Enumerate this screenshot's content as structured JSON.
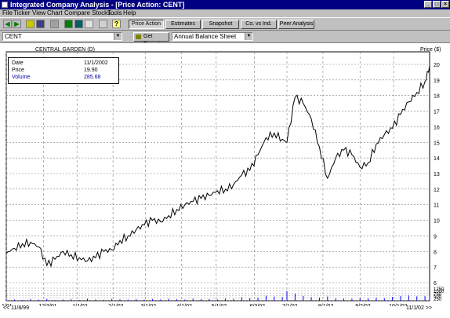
{
  "window": {
    "title": "Integrated Company Analysis - [Price Action:  CENT]",
    "controls": [
      "_",
      "□",
      "×"
    ]
  },
  "menu": [
    "File",
    "Ticker",
    "View",
    "Chart",
    "Compare Stocks...",
    "Tools",
    "Help"
  ],
  "toolbar": {
    "icons": [
      "back-arrow-icon",
      "forward-arrow-icon",
      "open-folder-icon",
      "save-icon",
      "print-icon",
      "chart-icon",
      "table-icon",
      "excel-icon",
      "copy-icon",
      "help-icon"
    ],
    "tabs": [
      "Price Action",
      "Estimates",
      "Snapshot",
      "Co. vs Ind.",
      "Peer Analysis"
    ],
    "active_tab": "Price Action"
  },
  "ticker_combo": "CENT",
  "get_report_label": "Get Report",
  "report_combo": "Annual Balance Sheet",
  "chart_header": {
    "company": "CENTRAL GARDEN (D)",
    "price_axis_title": "Price ($)"
  },
  "info": {
    "date_label": "Date",
    "date_value": "11/1/2002",
    "price_label": "Price",
    "price_value": "19.90",
    "volume_label": "Volume",
    "volume_value": "285.68"
  },
  "scroll": {
    "left_label": "<< 11/8/99",
    "right_label": "11/1/02 >>"
  },
  "colors": {
    "titlebar": "#000080",
    "line": "#000000",
    "volume": "#0000ff",
    "grid": "#808080"
  },
  "chart_data": {
    "type": "line",
    "title": "CENTRAL GARDEN (D)",
    "ylabel": "Price ($)",
    "ylim": [
      6,
      20
    ],
    "y_ticks": [
      6,
      7,
      8,
      9,
      10,
      11,
      12,
      13,
      14,
      15,
      16,
      17,
      18,
      19,
      20
    ],
    "x_ticks": [
      "1/01",
      "12/3/01",
      "1/1/02",
      "2/1/02",
      "3/1/02",
      "4/1/02",
      "5/1/02",
      "6/3/02",
      "7/1/02",
      "8/1/02",
      "9/2/02",
      "10/1/02"
    ],
    "series": [
      {
        "x": [
          "2001-11-01",
          "2001-11-08",
          "2001-11-15",
          "2001-11-22",
          "2001-11-29",
          "2001-12-06",
          "2001-12-13",
          "2001-12-20",
          "2001-12-27",
          "2002-01-03",
          "2002-01-10",
          "2002-01-17",
          "2002-01-24",
          "2002-01-31",
          "2002-02-07",
          "2002-02-14",
          "2002-02-21",
          "2002-02-28",
          "2002-03-07",
          "2002-03-14",
          "2002-03-21",
          "2002-03-28",
          "2002-04-04",
          "2002-04-11",
          "2002-04-18",
          "2002-04-25",
          "2002-05-02",
          "2002-05-09",
          "2002-05-16",
          "2002-05-23",
          "2002-05-30",
          "2002-06-06",
          "2002-06-13",
          "2002-06-20",
          "2002-06-27",
          "2002-07-01",
          "2002-07-08",
          "2002-07-15",
          "2002-07-22",
          "2002-07-29",
          "2002-08-05",
          "2002-08-12",
          "2002-08-19",
          "2002-08-26",
          "2002-09-02",
          "2002-09-09",
          "2002-09-16",
          "2002-09-23",
          "2002-09-30",
          "2002-10-07",
          "2002-10-14",
          "2002-10-21",
          "2002-10-28",
          "2002-11-01"
        ],
        "values": [
          7.9,
          8.2,
          8.5,
          8.6,
          8.3,
          7.1,
          7.5,
          8.0,
          7.8,
          7.6,
          7.4,
          7.6,
          8.0,
          8.1,
          8.7,
          9.0,
          9.4,
          9.7,
          10.0,
          9.9,
          10.3,
          10.7,
          11.0,
          11.2,
          11.4,
          11.6,
          11.9,
          12.0,
          12.3,
          12.9,
          13.2,
          14.2,
          15.3,
          15.6,
          15.2,
          15.0,
          17.9,
          17.5,
          16.5,
          14.7,
          12.7,
          14.0,
          14.5,
          14.2,
          13.4,
          13.7,
          14.9,
          15.5,
          15.9,
          16.8,
          17.6,
          18.2,
          18.9,
          19.9
        ]
      }
    ],
    "volume": {
      "ylim": [
        0,
        1250
      ],
      "y_ticks": [
        0,
        250,
        500,
        750,
        1000,
        1250
      ],
      "values": [
        90,
        120,
        70,
        150,
        100,
        180,
        60,
        110,
        140,
        80,
        200,
        120,
        90,
        160,
        130,
        110,
        150,
        100,
        170,
        120,
        180,
        140,
        110,
        200,
        150,
        160,
        130,
        220,
        180,
        350,
        260,
        300,
        500,
        420,
        380,
        950,
        700,
        480,
        360,
        300,
        420,
        240,
        210,
        200,
        260,
        230,
        300,
        250,
        380,
        480,
        520,
        440,
        460,
        420
      ]
    }
  }
}
